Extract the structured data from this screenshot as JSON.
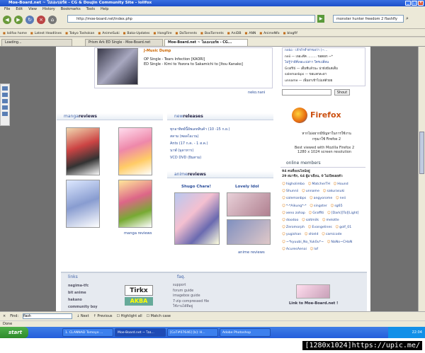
{
  "window": {
    "title": "Moe-Board.net ~ โมเอะบอร์ด - CG & Doujin Community Site - lolifox"
  },
  "menu": [
    "File",
    "Edit",
    "View",
    "History",
    "Bookmarks",
    "Tools",
    "Help"
  ],
  "nav": {
    "url": "http://moe-board.net/index.php",
    "search": "monster hunter freedom 2 flashfly"
  },
  "bookmarks": [
    "lolifox home",
    "Latest Headlines",
    "Tokyo Toshokan",
    "AnimeSuki",
    "Baka-Updates",
    "HongFire",
    "DaTorrents",
    "BoxTorrents",
    "AniDB",
    "ANN",
    "AnimeNfo",
    "blogfif"
  ],
  "tabs": [
    {
      "label": "Loading..."
    },
    {
      "label": "Prism Ark ED Single - Moe-Board.net"
    },
    {
      "label": "Moe-Board.net ~ โมเอะบอร์ด - CG..."
    }
  ],
  "music": {
    "heading": "J-Music Dump",
    "line1": "OP Single - Tears Infection [KAORI]",
    "line2": "ED Single - Kimi to Yozora to Sakamichi to [Itou Kanako]",
    "link": "neko.nani"
  },
  "shoutbox": {
    "lines": [
      "neko - เจ้าถ้าทำท่าขอว่า (~...",
      "neii — เจอะดีค ......... ขอตอก ~*",
      "ไม่รู้ว่ามีที่เจอะเปล่าา ใครเปลี่ยน",
      "Graffiti — เต็มทีแล้วนะ น่ายังมีแต่เต็ม",
      "salemanbps — ขอแลกละอา",
      "unname — เพิ่มอาเข้าไปแต่ด้วยย"
    ],
    "button": "Shout"
  },
  "manga": {
    "heading_a": "manga",
    "heading_b": "reviews",
    "link": "manga reviews"
  },
  "releases": {
    "heading_a": "new",
    "heading_b": "releases",
    "items": [
      "ทุกอาทิตย์นี้อัพเดทสินค้า (10 -15 ก.ย.)",
      "สลาม (พอลไอเวน)",
      "Ants (17 ก.ค. - 1 ส.ค.)",
      "นาฬ (มุดาหาร)",
      "VCD DVD (ยิมสาม)"
    ]
  },
  "anime": {
    "heading_a": "anime",
    "heading_b": "reviews",
    "item1": "Shugo Chara!",
    "item2": "Lovely Idol",
    "link": "anime reviews"
  },
  "firefox": {
    "name": "Firefox",
    "text1": "หากไม่อยากมีปัญหาในการใช้งาน",
    "text2": "กรุณาใช้ Firefox 2",
    "best1": "Best viewed with Mozilla Firefox 2",
    "best2": "1280 x 1024 screen resolution"
  },
  "online": {
    "heading": "online members",
    "count": "94 คนที่ออนไลน์อยู่",
    "date": "29 สมาชิก, 64 ผู้มาเยือน, 0 ไม่เปิดเผยตัว",
    "members": [
      "higholimbo",
      "MatcherTH",
      "Hound",
      "Shunnii",
      "unname",
      "sakurasuki",
      "salemanbps",
      "angyorome",
      "neii",
      "*-*Aikung*-*",
      "singster",
      "sg65",
      "xeno zohap",
      "Graffiti",
      "[Dark][To][Light]",
      "doodoo",
      "saltmilk",
      "melotte",
      "Zeromorph",
      "Evangelines",
      "golf_01",
      "yugishan",
      "shield",
      "camicode",
      "~*kyuubi_No_Yuk0u*~",
      "NaNo~CHaN",
      "AcuresAenai",
      "lof"
    ]
  },
  "links": {
    "heading_b": "links",
    "items": [
      "negima-tfc",
      "bit anime",
      "hakano",
      "community boy"
    ],
    "banner1": "Tirkx",
    "banner2": "AKBA"
  },
  "faq": {
    "heading_b": "faq.",
    "items": [
      "support",
      "forum guide",
      "imagebox guide",
      "7-zip compressed file",
      "ใช้งานได้ดีอยู่"
    ]
  },
  "linkto": {
    "label": "Link to Moe-Board.net !"
  },
  "findbar": {
    "label": "Find:",
    "value": "flash",
    "next": "Next",
    "previous": "Previous",
    "highlight": "Highlight all",
    "match": "Match case"
  },
  "status": "Done",
  "taskbar": {
    "start": "start",
    "tasks": [
      "1. CLANNAD Tomoyo ...",
      "Moe-Board.net ~ โมเ...",
      "[CoT#07646] [b]: H...",
      "Adobe Photoshop"
    ],
    "clock": "22:04"
  },
  "caption": {
    "text": "[1280x1024]https://upic.me/"
  }
}
